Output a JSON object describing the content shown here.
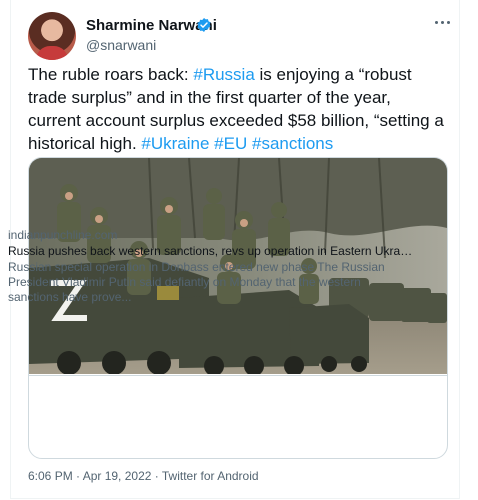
{
  "author": {
    "name": "Sharmine Narwani",
    "handle": "@snarwani",
    "verified": true
  },
  "tweet": {
    "segments": [
      {
        "text": "The ruble roars back: ",
        "kind": "text"
      },
      {
        "text": "#Russia",
        "kind": "hashtag"
      },
      {
        "text": " is enjoying a “robust trade surplus” and in the first quarter of the year, current account surplus exceeded $58 billion, “setting a historical high. ",
        "kind": "text"
      },
      {
        "text": "#Ukraine",
        "kind": "hashtag"
      },
      {
        "text": " ",
        "kind": "text"
      },
      {
        "text": "#EU",
        "kind": "hashtag"
      },
      {
        "text": " ",
        "kind": "text"
      },
      {
        "text": "#sanctions",
        "kind": "hashtag"
      }
    ]
  },
  "card": {
    "image_icon": "military-convoy-photo",
    "domain": "indianpunchline.com",
    "title": "Russia pushes back western sanctions, revs up operation in Eastern Ukraine - I...",
    "description": "Russian special operation in Donbass entered new phase The Russian President Vladimir Putin said defiantly on Monday that the western sanctions have prove..."
  },
  "meta": {
    "line": "6:06 PM · Apr 19, 2022 · Twitter for Android"
  },
  "colors": {
    "link": "#1d9bf0",
    "muted": "#536471",
    "border": "#cfd9de"
  },
  "icons": {
    "more": "more-dots-icon",
    "verified": "verified-badge-icon"
  }
}
